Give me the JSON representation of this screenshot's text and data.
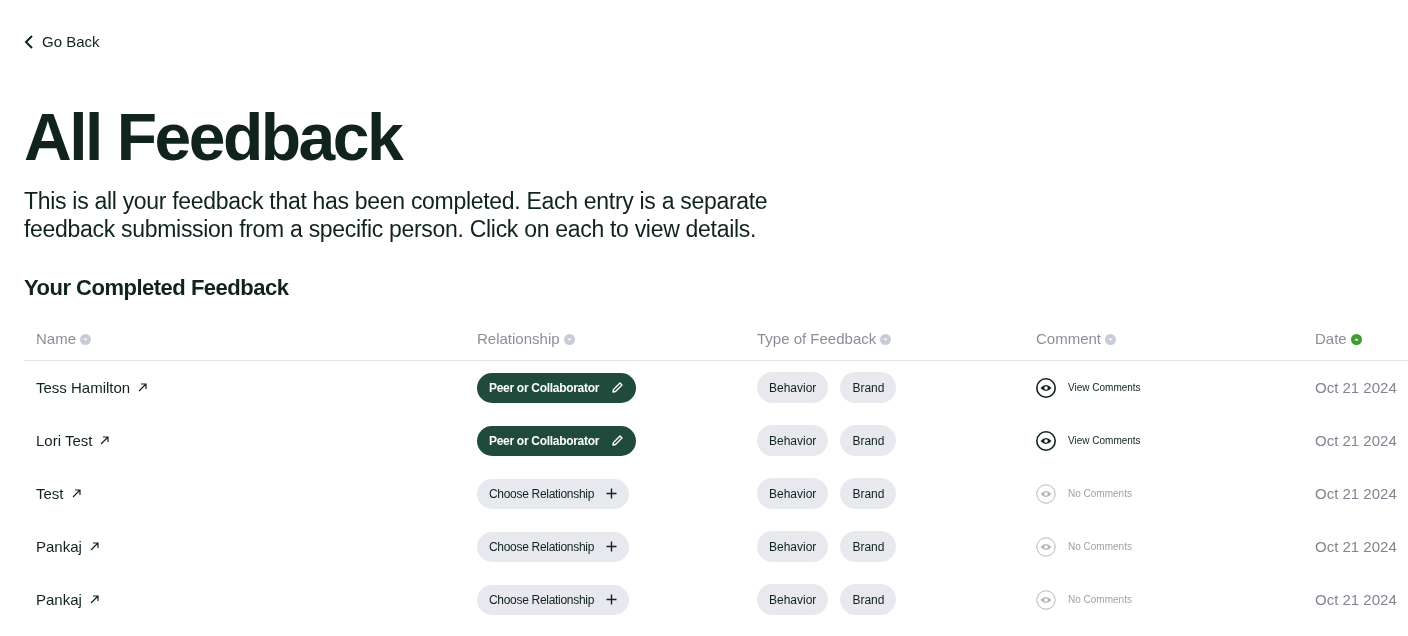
{
  "back_link": {
    "label": "Go Back"
  },
  "title": "All Feedback",
  "description": "This is all your feedback that has been completed. Each entry is a separate feedback submission from a specific person. Click on each to view details.",
  "section_title": "Your Completed Feedback",
  "table": {
    "columns": [
      {
        "label": "Name",
        "sorted": false
      },
      {
        "label": "Relationship",
        "sorted": false
      },
      {
        "label": "Type of Feedback",
        "sorted": false
      },
      {
        "label": "Comment",
        "sorted": false
      },
      {
        "label": "Date",
        "sorted": true
      }
    ],
    "rows": [
      {
        "name": "Tess Hamilton",
        "relationship": {
          "kind": "set",
          "label": "Peer or Collaborator"
        },
        "types": [
          "Behavior",
          "Brand"
        ],
        "comment": {
          "has_comments": true,
          "label": "View Comments"
        },
        "date": "Oct 21 2024"
      },
      {
        "name": "Lori Test",
        "relationship": {
          "kind": "set",
          "label": "Peer or Collaborator"
        },
        "types": [
          "Behavior",
          "Brand"
        ],
        "comment": {
          "has_comments": true,
          "label": "View Comments"
        },
        "date": "Oct 21 2024"
      },
      {
        "name": "Test",
        "relationship": {
          "kind": "empty",
          "label": "Choose Relationship"
        },
        "types": [
          "Behavior",
          "Brand"
        ],
        "comment": {
          "has_comments": false,
          "label": "No Comments"
        },
        "date": "Oct 21 2024"
      },
      {
        "name": "Pankaj",
        "relationship": {
          "kind": "empty",
          "label": "Choose Relationship"
        },
        "types": [
          "Behavior",
          "Brand"
        ],
        "comment": {
          "has_comments": false,
          "label": "No Comments"
        },
        "date": "Oct 21 2024"
      },
      {
        "name": "Pankaj",
        "relationship": {
          "kind": "empty",
          "label": "Choose Relationship"
        },
        "types": [
          "Behavior",
          "Brand"
        ],
        "comment": {
          "has_comments": false,
          "label": "No Comments"
        },
        "date": "Oct 21 2024"
      }
    ]
  }
}
